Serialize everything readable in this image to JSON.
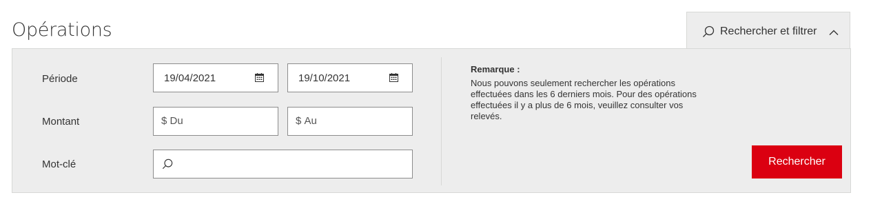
{
  "header": {
    "title": "Opérations",
    "filter_toggle_label": "Rechercher et filtrer"
  },
  "form": {
    "period_label": "Période",
    "period_from": "19/04/2021",
    "period_to": "19/10/2021",
    "amount_label": "Montant",
    "amount_from_prefix": "$",
    "amount_from_placeholder": "Du",
    "amount_to_prefix": "$",
    "amount_to_placeholder": "Au",
    "keyword_label": "Mot-clé",
    "keyword_value": ""
  },
  "note": {
    "title": "Remarque :",
    "body": "Nous pouvons seulement rechercher les opérations effectuées dans les 6 derniers mois. Pour des opérations effectuées il y a plus de 6 mois, veuillez consulter vos relevés."
  },
  "actions": {
    "search_label": "Rechercher"
  },
  "colors": {
    "accent": "#db0011",
    "panel_bg": "#ededed",
    "border": "#d7d8d6"
  },
  "icons": {
    "toggle_search": "search-icon",
    "toggle_chevron": "chevron-up-icon",
    "date": "calendar-icon",
    "keyword": "search-icon"
  }
}
